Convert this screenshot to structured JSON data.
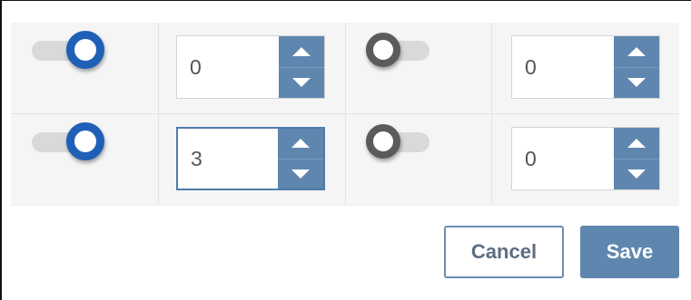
{
  "rows": [
    {
      "toggle_a": {
        "state": "on",
        "color": "#1f5fb8"
      },
      "value_a": "0",
      "toggle_b": {
        "state": "off",
        "color": "#5b5b5b"
      },
      "value_b": "0"
    },
    {
      "toggle_a": {
        "state": "on",
        "color": "#1f5fb8"
      },
      "value_a": "3",
      "toggle_b": {
        "state": "off",
        "color": "#5b5b5b"
      },
      "value_b": "0"
    }
  ],
  "icons": {
    "increment": "chevron-up-icon",
    "decrement": "chevron-down-icon"
  },
  "actions": {
    "cancel_label": "Cancel",
    "save_label": "Save"
  },
  "colors": {
    "accent": "#5f86ae",
    "toggle_on": "#1f5fb8",
    "toggle_off": "#5b5b5b"
  }
}
